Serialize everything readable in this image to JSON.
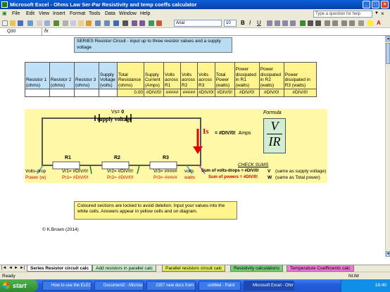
{
  "window": {
    "title": "Microsoft Excel - Ohms Law Ser-Par Resistivity and temp coeffs calculator"
  },
  "menu": {
    "items": [
      "File",
      "Edit",
      "View",
      "Insert",
      "Format",
      "Tools",
      "Data",
      "Window",
      "Help"
    ],
    "help_placeholder": "Type a question for help"
  },
  "toolbar": {
    "font": "Arial",
    "size": "10"
  },
  "formula_bar": {
    "cell": "Q30"
  },
  "sheet": {
    "title_note": "SERIES Resistor Circuit - input up to three resistor values and a supply voltage",
    "headers": [
      "Resistor 1 (ohms)",
      "Resistor 2 (ohms)",
      "Resistor 3 (ohms)",
      "Supply Voltage (volts)",
      "Total Resistance (ohms)",
      "Supply Current (Amps)",
      "Volts across R1",
      "Volts across R2",
      "Volts across R3",
      "Total Power (watts)",
      "Power dissipated in R1 (watts)",
      "Power dissipated in R2 (watts)",
      "Power dissipated in R3 (watts)"
    ],
    "values": [
      "",
      "",
      "",
      "",
      "0.00",
      "#DIV/0!",
      "#####",
      "#####",
      "#DIV/0!",
      "#DIV/0!",
      "#DIV/0!",
      "#DIV/0!",
      "#DIV/0!"
    ],
    "diagram": {
      "vs_label": "Vs=",
      "vs_value": "0",
      "supply_label": "supply voltage",
      "is_label": "Is",
      "is_value": "= #DIV/0!",
      "is_unit": "Amps",
      "r1": "R1",
      "r2": "R2",
      "r3": "R3",
      "formula_label": "Formula",
      "formula_num": "V",
      "formula_den": "IR",
      "volts_drop_label": "Volts-drop",
      "power_label": "Power (w)",
      "vr1": "Vr1= #DIV/0!",
      "vr2": "Vr2= #DIV/0!",
      "vr3": "Vr3= #####",
      "vr_unit": "volts",
      "pr1": "Pr1= #DIV/0!",
      "pr2": "Pr2= #DIV/0!",
      "pr3": "Pr3= #####",
      "pr_unit": "watts",
      "check_title": "CHECK SUMS",
      "check1_label": "Sum of volts-drops = #DIV/0!",
      "check1_v": "V",
      "check1_note": "(same as supply voltage)",
      "check2_label": "Sum of powers = #DIV/0!",
      "check2_v": "W",
      "check2_note": "(same as Total power)"
    },
    "note": "Coloured sections are locked to avoid deletion. Input your values into the white cells. Answers appear in yellow cells and on diagram.",
    "copyright": "© K.Brown (2014)"
  },
  "tabs": [
    "Series Resistor circuit calc",
    "Add resistors in parallel calc",
    "Parallel resistors circuit calc",
    "Resistivity calculations",
    "Temperature Coefficients calc"
  ],
  "status": {
    "left": "Ready",
    "right": "NUM"
  },
  "taskbar": {
    "start": "start",
    "tasks": [
      "How to use the ELEC...",
      "Document2 - Microsof...",
      "2357 new docs from ...",
      "untitled - Paint",
      "Microsoft Excel - Ohm..."
    ],
    "time": "16:40"
  },
  "colors": {
    "accent": "#0a5fd8",
    "yellow_cell": "#fff48d",
    "blue_cell": "#bfe0f7",
    "arrow": "#e00000"
  }
}
